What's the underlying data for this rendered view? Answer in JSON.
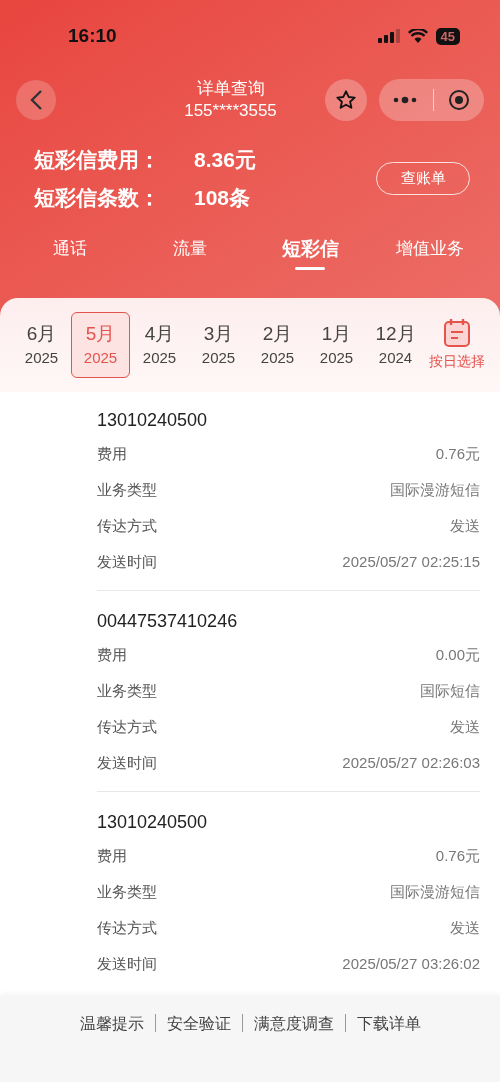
{
  "status_bar": {
    "time": "16:10",
    "battery": "45"
  },
  "nav": {
    "title": "详单查询",
    "subtitle": "155****3555"
  },
  "summary": [
    {
      "label": "短彩信费用：",
      "value": "8.36元"
    },
    {
      "label": "短彩信条数：",
      "value": "108条"
    }
  ],
  "bill_button": "查账单",
  "tabs": [
    {
      "label": "通话",
      "selected": false
    },
    {
      "label": "流量",
      "selected": false
    },
    {
      "label": "短彩信",
      "selected": true
    },
    {
      "label": "增值业务",
      "selected": false
    }
  ],
  "months": [
    {
      "month": "6月",
      "year": "2025",
      "selected": false
    },
    {
      "month": "5月",
      "year": "2025",
      "selected": true
    },
    {
      "month": "4月",
      "year": "2025",
      "selected": false
    },
    {
      "month": "3月",
      "year": "2025",
      "selected": false
    },
    {
      "month": "2月",
      "year": "2025",
      "selected": false
    },
    {
      "month": "1月",
      "year": "2025",
      "selected": false
    },
    {
      "month": "12月",
      "year": "2024",
      "selected": false
    }
  ],
  "date_picker": "按日选择",
  "records": [
    {
      "number": "13010240500",
      "fields": [
        {
          "label": "费用",
          "value": "0.76元"
        },
        {
          "label": "业务类型",
          "value": "国际漫游短信"
        },
        {
          "label": "传达方式",
          "value": "发送"
        },
        {
          "label": "发送时间",
          "value": "2025/05/27 02:25:15"
        }
      ]
    },
    {
      "number": "00447537410246",
      "fields": [
        {
          "label": "费用",
          "value": "0.00元"
        },
        {
          "label": "业务类型",
          "value": "国际短信"
        },
        {
          "label": "传达方式",
          "value": "发送"
        },
        {
          "label": "发送时间",
          "value": "2025/05/27 02:26:03"
        }
      ]
    },
    {
      "number": "13010240500",
      "fields": [
        {
          "label": "费用",
          "value": "0.76元"
        },
        {
          "label": "业务类型",
          "value": "国际漫游短信"
        },
        {
          "label": "传达方式",
          "value": "发送"
        },
        {
          "label": "发送时间",
          "value": "2025/05/27 03:26:02"
        }
      ]
    }
  ],
  "footer_links": [
    "温馨提示",
    "安全验证",
    "满意度调查",
    "下载详单"
  ]
}
